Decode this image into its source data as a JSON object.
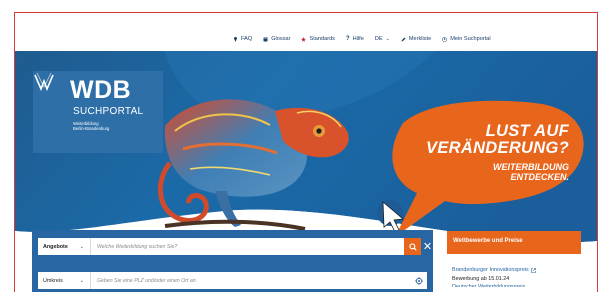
{
  "nav": {
    "faq": "FAQ",
    "glossar": "Glossar",
    "standards": "Standards",
    "hilfe": "Hilfe",
    "language": "DE",
    "merkliste": "Merkliste",
    "mein_suchportal": "Mein Suchportal"
  },
  "logo": {
    "wdb": "WDB",
    "suchportal": "SUCHPORTAL",
    "sub_line1": "Weiterbildung",
    "sub_line2": "Berlin-Brandenburg"
  },
  "hero": {
    "line1": "LUST AUF",
    "line2": "VERÄNDERUNG?",
    "line3": "WEITERBILDUNG",
    "line4": "ENTDECKEN."
  },
  "search": {
    "type_select": "Angebote",
    "query_placeholder": "Welche Weiterbildung suchen Sie?",
    "radius_select": "Umkreis",
    "location_placeholder": "Geben Sie eine PLZ und/oder einen Ort an."
  },
  "side": {
    "heading": "Wettbewerbe und Preise",
    "item_link": "Brandenburger Innovationspreis",
    "item_text": "Bewerbung ab 15.01.24",
    "item_next": "Deutscher Weiterbildungspreis"
  },
  "colors": {
    "brand_blue": "#2766a3",
    "accent_orange": "#e8651c",
    "dark_navy": "#1d3d6b"
  }
}
